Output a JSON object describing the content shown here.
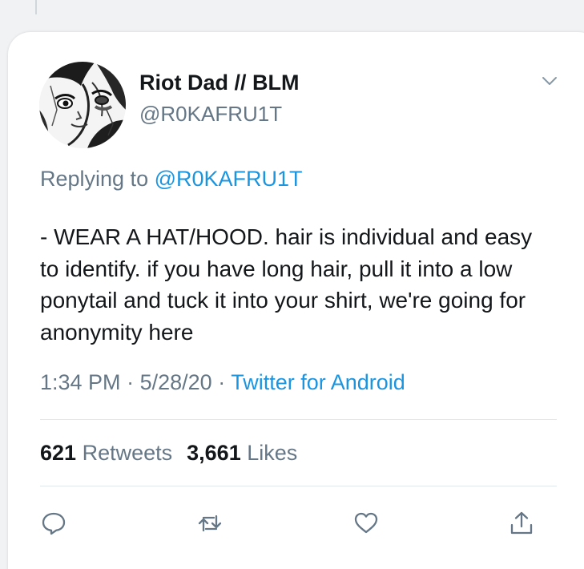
{
  "tweet": {
    "display_name": "Riot Dad // BLM",
    "handle": "@R0KAFRU1T",
    "replying_prefix": "Replying to",
    "replying_to": "@R0KAFRU1T",
    "text": "- WEAR A HAT/HOOD. hair is individual and easy to identify. if you have long hair, pull it into a low ponytail and tuck it into your shirt, we're going for anonymity here",
    "time": "1:34 PM",
    "date": "5/28/20",
    "separator": "·",
    "source": "Twitter for Android",
    "retweets_count": "621",
    "retweets_label": "Retweets",
    "likes_count": "3,661",
    "likes_label": "Likes"
  },
  "icons": {
    "menu": "chevron-down-icon",
    "reply": "reply-icon",
    "retweet": "retweet-icon",
    "like": "heart-icon",
    "share": "share-icon"
  },
  "colors": {
    "text": "#14171a",
    "secondary": "#657786",
    "link": "#1b95e0",
    "divider": "#e1e8ed",
    "background": "#f1f2f4"
  }
}
